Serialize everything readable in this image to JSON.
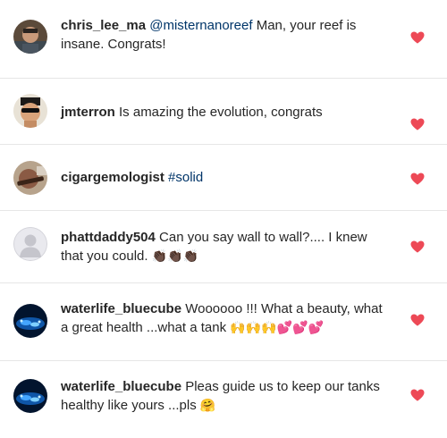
{
  "comments": [
    {
      "username": "chris_lee_ma",
      "mention": "@misternanoreef",
      "text": " Man, your reef is insane. Congrats!",
      "emoji": ""
    },
    {
      "username": "jmterron",
      "text": " Is  amazing the evolution, congrats",
      "emoji": ""
    },
    {
      "username": "cigargemologist",
      "hashtag": " #solid",
      "text": "",
      "emoji": ""
    },
    {
      "username": "phattdaddy504",
      "text": " Can you say wall to wall?.... I knew that you could. ",
      "emoji": "👏🏿👏🏿👏🏿"
    },
    {
      "username": "waterlife_bluecube",
      "text": " Woooooo !!! What a beauty, what a great health ...what a tank ",
      "emoji": "🙌🙌🙌💕💕💕"
    },
    {
      "username": "waterlife_bluecube",
      "text": " Pleas guide us to keep our tanks healthy like yours ...pls ",
      "emoji": "🤗"
    }
  ],
  "colors": {
    "like_heart": "#ed4956",
    "link": "#003569",
    "text": "#262626",
    "divider": "#e6e6e6"
  },
  "icons": {
    "like": "heart-icon"
  }
}
